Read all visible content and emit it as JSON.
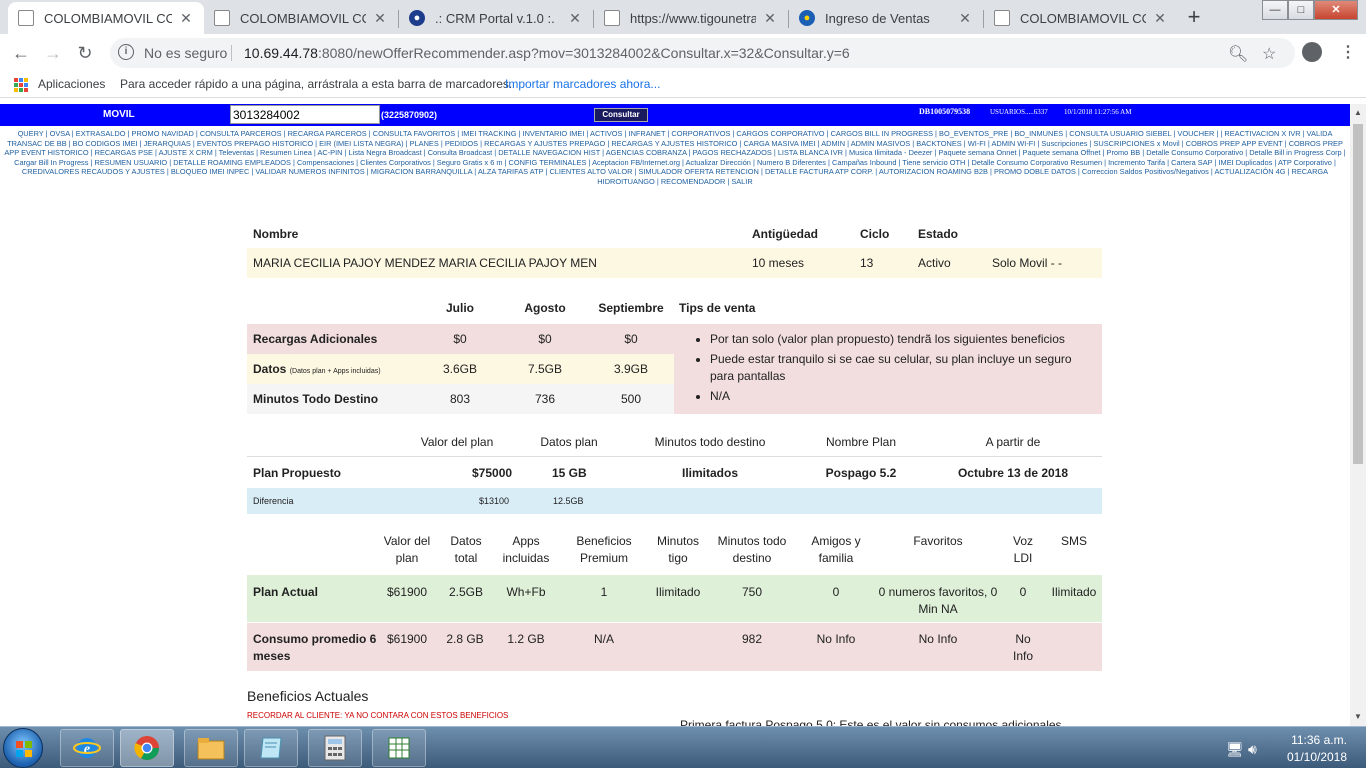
{
  "browser": {
    "tabs": [
      {
        "label": "COLOMBIAMOVIL CONS",
        "active": true
      },
      {
        "label": "COLOMBIAMOVIL CONS",
        "active": false
      },
      {
        "label": ".: CRM Portal v.1.0 :.",
        "active": false
      },
      {
        "label": "https://www.tigounetrai",
        "active": false
      },
      {
        "label": "Ingreso de Ventas",
        "active": false
      },
      {
        "label": "COLOMBIAMOVIL CONS",
        "active": false
      }
    ],
    "close_glyph": "✕",
    "new_tab": "+",
    "security_label": "No es seguro",
    "url_host": "10.69.44.78",
    "url_rest": ":8080/newOfferRecommender.asp?mov=3013284002&Consultar.x=32&Consultar.y=6",
    "bookmarks_apps": "Aplicaciones",
    "bookmarks_hint": "Para acceder rápido a una página, arrástrala a esta barra de marcadores.",
    "bookmarks_import": "Importar marcadores ahora..."
  },
  "header": {
    "movil_label": "MOVIL",
    "phone_value": "3013284002",
    "phone_alt": "(3225870902)",
    "consultar_label": "Consultar",
    "db_id": "DB1005079538",
    "usuario": "USUARIOS.....6337",
    "datetime": "10/1/2018 11:27:56 AM"
  },
  "menu_links": [
    "QUERY",
    "OVSA",
    "EXTRASALDO",
    "PROMO NAVIDAD",
    "CONSULTA PARCEROS",
    "RECARGA PARCEROS",
    "CONSULTA FAVORITOS",
    "IMEI TRACKING",
    "INVENTARIO IMEI",
    "ACTIVOS",
    "INFRANET",
    "CORPORATIVOS",
    "CARGOS CORPORATIVO",
    "CARGOS BILL IN PROGRESS",
    "BO_EVENTOS_PRE",
    "BO_INMUNES",
    "CONSULTA USUARIO SIEBEL",
    "VOUCHER",
    "",
    "REACTIVACION X IVR",
    "VALIDA TRANSAC DE BB",
    "BO CODIGOS IMEI",
    "JERARQUIAS",
    "EVENTOS PREPAGO HISTORICO",
    "EIR (IMEI LISTA NEGRA)",
    "PLANES",
    "PEDIDOS",
    "RECARGAS Y AJUSTES PREPAGO",
    "RECARGAS Y AJUSTES HISTORICO",
    "CARGA MASIVA IMEI",
    "ADMIN",
    "ADMIN MASIVOS",
    "BACKTONES",
    "WI-FI",
    "ADMIN WI-FI",
    "Suscripciones",
    "SUSCRIPCIONES x Movil",
    "COBROS PREP APP EVENT",
    "COBROS PREP APP EVENT HISTORICO",
    "RECARGAS PSE",
    "AJUSTE X CRM",
    "Televentas",
    "Resumen Linea",
    "AC-PIN",
    "Lista Negra Broadcast",
    "Consulta Broadcast",
    "DETALLE NAVEGACION HIST",
    "AGENCIAS COBRANZA",
    "PAGOS RECHAZADOS",
    "LISTA BLANCA IVR",
    "Musica Ilimitada - Deezer",
    "Paquete semana Onnet",
    "Paquete semana Offnet",
    "Promo BB",
    "Detalle Consumo Corporativo",
    "Detalle Bill in Progress Corp",
    "Cargar Bill In Progress",
    "RESUMEN USUARIO",
    "DETALLE ROAMING EMPLEADOS",
    "Compensaciones",
    "Clientes Corporativos",
    "Seguro Gratis x 6 m",
    "CONFIG TERMINALES",
    "Aceptacion FB/Internet.org",
    "Actualizar Dirección",
    "Numero B Diferentes",
    "Campañas Inbound",
    "Tiene servicio OTH",
    "Detalle Consumo Corporativo Resumen",
    "Incremento Tarifa",
    "Cartera SAP",
    "IMEI Duplicados",
    "ATP Corporativo",
    "CREDIVALORES RECAUDOS Y AJUSTES",
    "BLOQUEO IMEI INPEC",
    "VALIDAR NUMEROS INFINITOS",
    "MIGRACION BARRANQUILLA",
    "ALZA TARIFAS ATP",
    "CLIENTES ALTO VALOR",
    "SIMULADOR OFERTA RETENCION",
    "DETALLE FACTURA ATP CORP.",
    "AUTORIZACION ROAMING B2B",
    "PROMO DOBLE DATOS",
    "Correccion Saldos Positivos/Negativos",
    "ACTUALIZACIÓN 4G",
    "RECARGA HIDROITUANGO",
    "RECOMENDADOR",
    "SALIR"
  ],
  "customer": {
    "headers": {
      "nombre": "Nombre",
      "antiguedad": "Antigüedad",
      "ciclo": "Ciclo",
      "estado": "Estado"
    },
    "nombre": "MARIA CECILIA PAJOY MENDEZ MARIA CECILIA PAJOY MEN",
    "antiguedad": "10 meses",
    "ciclo": "13",
    "estado": "Activo",
    "tipo": "Solo Movil - -"
  },
  "usage": {
    "months": [
      "Julio",
      "Agosto",
      "Septiembre"
    ],
    "tips_title": "Tips de venta",
    "rows": [
      {
        "label": "Recargas Adicionales",
        "sublabel": "",
        "values": [
          "$0",
          "$0",
          "$0"
        ]
      },
      {
        "label": "Datos",
        "sublabel": "(Datos plan + Apps incluidas)",
        "values": [
          "3.6GB",
          "7.5GB",
          "3.9GB"
        ]
      },
      {
        "label": "Minutos Todo Destino",
        "sublabel": "",
        "values": [
          "803",
          "736",
          "500"
        ]
      }
    ],
    "tips": [
      "Por tan solo (valor plan propuesto) tendrã los siguientes beneficios",
      "Puede estar tranquilo si se cae su celular, su plan incluye un seguro para pantallas",
      "N/A"
    ]
  },
  "proposed": {
    "headers": [
      "Valor del plan",
      "Datos plan",
      "Minutos todo destino",
      "Nombre Plan",
      "A partir de"
    ],
    "label": "Plan Propuesto",
    "values": [
      "$75000",
      "15 GB",
      "Ilimitados",
      "Pospago 5.2",
      "Octubre 13 de 2018"
    ],
    "diff_label": "Diferencia",
    "diff_values": [
      "$13100",
      "12.5GB"
    ]
  },
  "current": {
    "headers": [
      "Valor del plan",
      "Datos total",
      "Apps incluidas",
      "Beneficios Premium",
      "Minutos tigo",
      "Minutos todo destino",
      "Amigos y familia",
      "Favoritos",
      "Voz LDI",
      "SMS"
    ],
    "rows": [
      {
        "label": "Plan Actual",
        "values": [
          "$61900",
          "2.5GB",
          "Wh+Fb",
          "1",
          "Ilimitado",
          "750",
          "0",
          "0 numeros favoritos, 0 Min NA",
          "0",
          "Ilimitado"
        ]
      },
      {
        "label": "Consumo promedio 6 meses",
        "values": [
          "$61900",
          "2.8 GB",
          "1.2 GB",
          "N/A",
          "",
          "982",
          "No Info",
          "No Info",
          "No Info",
          ""
        ]
      }
    ]
  },
  "benefits": {
    "title": "Beneficios Actuales",
    "note": "RECORDAR AL CLIENTE: YA NO CONTARA CON ESTOS BENEFICIOS",
    "right_text": "Primera factura Pospago 5.0: Este es el valor sin consumos adicionales"
  },
  "taskbar": {
    "time": "11:36 a.m.",
    "date": "01/10/2018"
  },
  "colors": {
    "header_blue": "#0000ff",
    "link_blue": "#2060a0",
    "yellow_row": "#fdf8e2",
    "pink_row": "#f2dede",
    "blue_row": "#d9edf7",
    "green_row": "#dff0d8"
  }
}
